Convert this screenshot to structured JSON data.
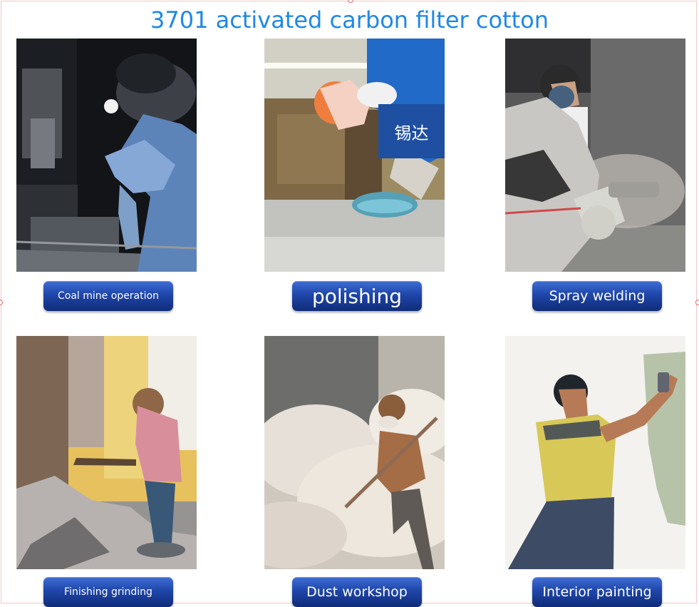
{
  "page": {
    "title": "3701 activated carbon filter cotton"
  },
  "cards": [
    {
      "label": "Coal mine operation",
      "image_icon": "coal-mine-worker-icon"
    },
    {
      "label": "polishing",
      "image_icon": "polishing-worker-icon",
      "watermark": "锡达"
    },
    {
      "label": "Spray welding",
      "image_icon": "spray-welding-worker-icon"
    },
    {
      "label": "Finishing grinding",
      "image_icon": "finishing-grinding-worker-icon"
    },
    {
      "label": "Dust workshop",
      "image_icon": "dust-workshop-worker-icon"
    },
    {
      "label": "Interior painting",
      "image_icon": "interior-painting-worker-icon"
    }
  ],
  "colors": {
    "title": "#1e88e5",
    "label_gradient_top": "#3f6ed6",
    "label_gradient_bottom": "#0f2c78",
    "watermark_bg": "#1f4fa1"
  }
}
